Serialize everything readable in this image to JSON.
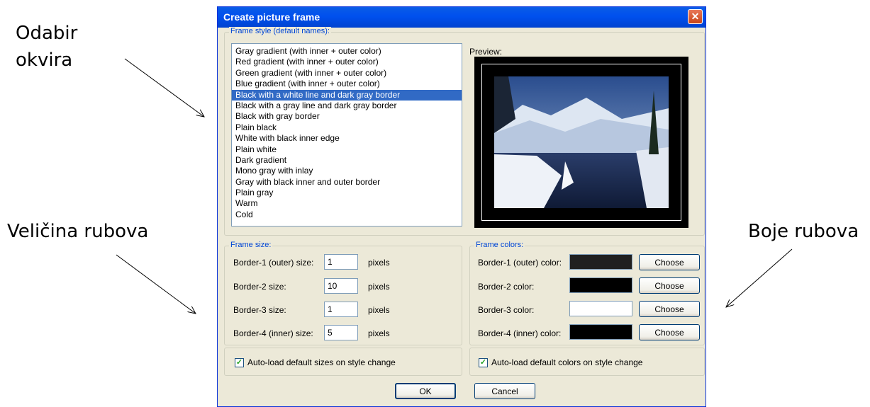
{
  "annotations": {
    "frame_choice_line1": "Odabir",
    "frame_choice_line2": "okvira",
    "border_sizes": "Veličina rubova",
    "border_colors": "Boje rubova"
  },
  "dialog": {
    "title": "Create picture frame",
    "close_glyph": "✕"
  },
  "frame_style": {
    "legend": "Frame style (default names):",
    "items": [
      "Gray gradient (with inner + outer color)",
      "Red gradient (with inner + outer color)",
      "Green gradient (with inner + outer color)",
      "Blue gradient (with inner + outer color)",
      "Black with a white line and dark gray border",
      "Black with a gray line and dark gray border",
      "Black with gray border",
      "Plain black",
      "White with black inner edge",
      "Plain white",
      "Dark gradient",
      "Mono gray with inlay",
      "Gray with black inner and outer border",
      "Plain gray",
      "Warm",
      "Cold"
    ],
    "selected_index": 4,
    "preview_label": "Preview:"
  },
  "frame_size": {
    "legend": "Frame size:",
    "unit": "pixels",
    "rows": [
      {
        "label": "Border-1 (outer) size:",
        "value": "1"
      },
      {
        "label": "Border-2 size:",
        "value": "10"
      },
      {
        "label": "Border-3 size:",
        "value": "1"
      },
      {
        "label": "Border-4 (inner) size:",
        "value": "5"
      }
    ],
    "autoload_label": "Auto-load default sizes on style change",
    "autoload_checked": true
  },
  "frame_colors": {
    "legend": "Frame colors:",
    "choose_label": "Choose",
    "rows": [
      {
        "label": "Border-1 (outer) color:",
        "color": "#202020"
      },
      {
        "label": "Border-2 color:",
        "color": "#000000"
      },
      {
        "label": "Border-3 color:",
        "color": "#ffffff"
      },
      {
        "label": "Border-4 (inner) color:",
        "color": "#000000"
      }
    ],
    "autoload_label": "Auto-load default colors on style change",
    "autoload_checked": true
  },
  "buttons": {
    "ok": "OK",
    "cancel": "Cancel"
  },
  "check_glyph": "✓"
}
